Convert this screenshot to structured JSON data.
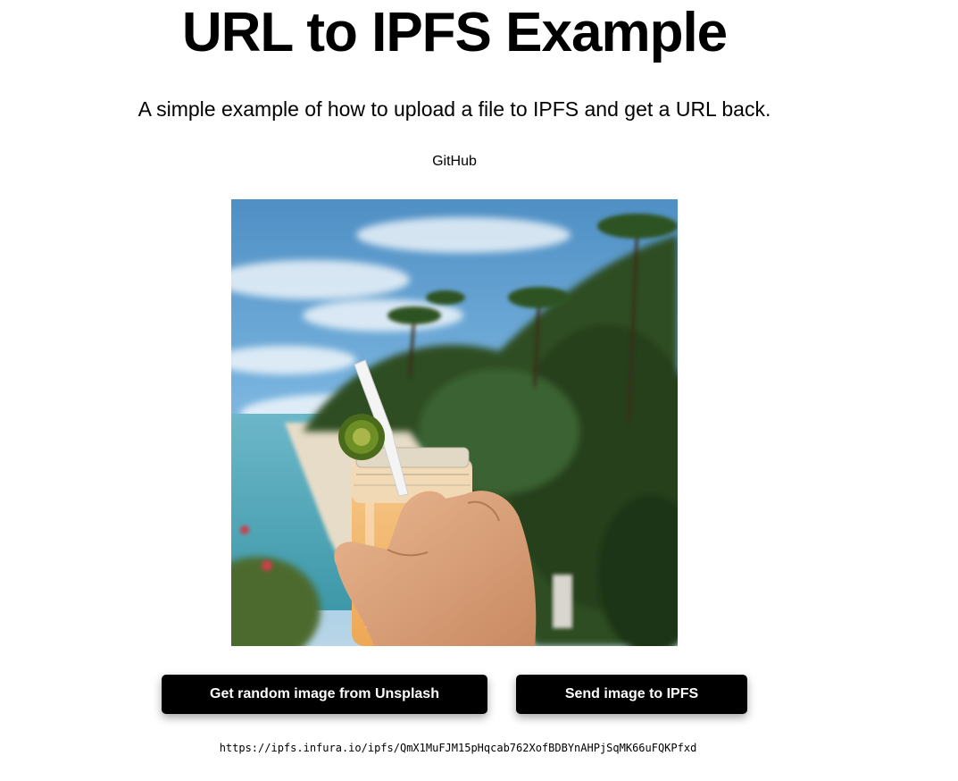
{
  "header": {
    "title": "URL to IPFS Example",
    "subtitle": "A simple example of how to upload a file to IPFS and get a URL back.",
    "github_link": "GitHub"
  },
  "image": {
    "alt": "Hand holding a jar of orange juice with a straw and lime in front of a tropical beach"
  },
  "actions": {
    "random_image_label": "Get random image from Unsplash",
    "send_ipfs_label": "Send image to IPFS"
  },
  "result": {
    "url": "https://ipfs.infura.io/ipfs/QmX1MuFJM15pHqcab762XofBDBYnAHPjSqMK66uFQKPfxd"
  },
  "colors": {
    "button_bg": "#000000",
    "button_text": "#ffffff",
    "page_bg": "#ffffff"
  }
}
